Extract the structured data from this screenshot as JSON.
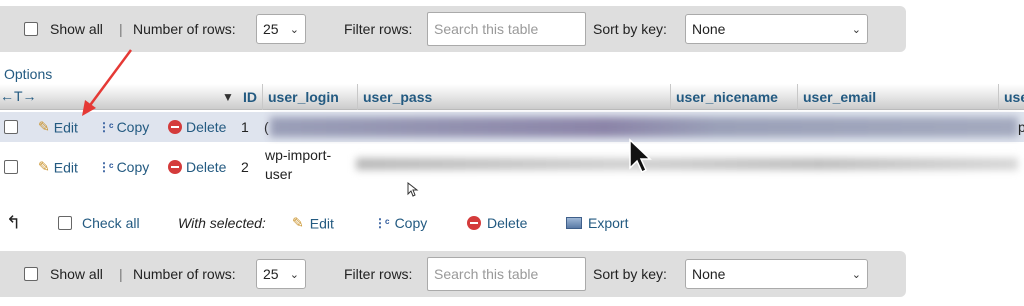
{
  "top_nav": {
    "show_all_label": "Show all",
    "separator": "|",
    "rows_label": "Number of rows:",
    "rows_value": "25",
    "filter_label": "Filter rows:",
    "filter_placeholder": "Search this table",
    "sort_label": "Sort by key:",
    "sort_value": "None"
  },
  "options_label": "Options",
  "header": {
    "arrows": "←T→",
    "sort_indicator": "▼",
    "columns": [
      "ID",
      "user_login",
      "user_pass",
      "user_nicename",
      "user_email",
      "use"
    ]
  },
  "rows": [
    {
      "edit": "Edit",
      "copy": "Copy",
      "delete": "Delete",
      "id": "1",
      "login_fragment": "(",
      "tail_fragment": "p"
    },
    {
      "edit": "Edit",
      "copy": "Copy",
      "delete": "Delete",
      "id": "2",
      "login_line1": "wp-import-",
      "login_line2": "user"
    }
  ],
  "bulk": {
    "return_arrow": "↰",
    "check_all": "Check all",
    "with_selected": "With selected:",
    "edit": "Edit",
    "copy": "Copy",
    "delete": "Delete",
    "export": "Export"
  },
  "bottom_nav": {
    "show_all_label": "Show all",
    "separator": "|",
    "rows_label": "Number of rows:",
    "rows_value": "25",
    "filter_label": "Filter rows:",
    "filter_placeholder": "Search this table",
    "sort_label": "Sort by key:",
    "sort_value": "None"
  },
  "colors": {
    "link": "#235a81",
    "annotation_arrow": "#e53935",
    "selected_row": "#dfe4ee",
    "nav_bar": "#dedede"
  }
}
